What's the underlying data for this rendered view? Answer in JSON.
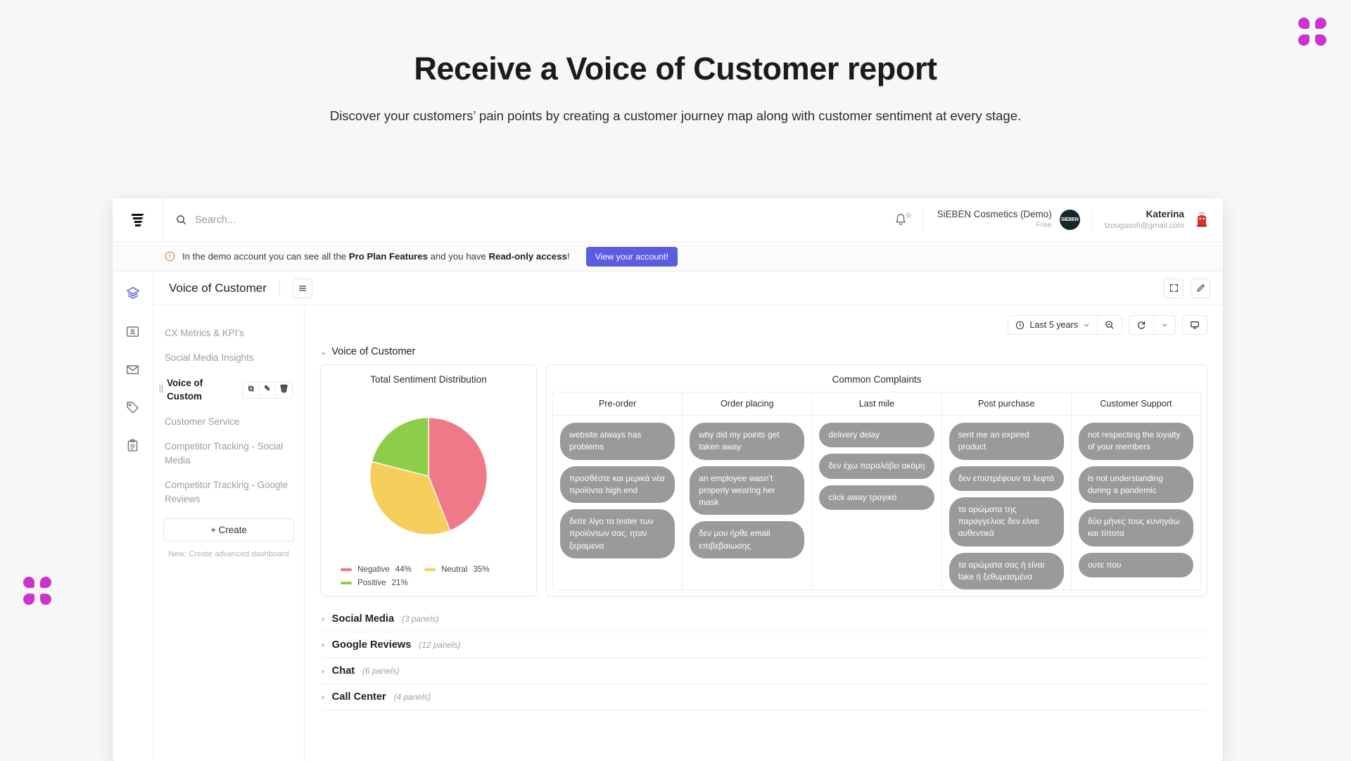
{
  "page": {
    "title": "Receive a Voice of Customer report",
    "subtitle": "Discover your customers’ pain points by creating a customer journey map along with customer sentiment at every stage."
  },
  "decor": {
    "petal_color": "#cc33cc"
  },
  "topbar": {
    "logo_icon": "app-logo-icon",
    "search_icon": "search-icon",
    "search_placeholder": "Search...",
    "bell_icon": "bell-icon",
    "org_name": "SiEBEN Cosmetics (Demo)",
    "org_plan": "Free",
    "org_avatar_text": "SiEBEN",
    "user_name": "Katerina",
    "user_email": "tzougasofi@gmail.com",
    "user_avatar_icon": "user-avatar-icon"
  },
  "banner": {
    "warn_icon": "warning-circle-icon",
    "text_1": "In the demo account you can see all the ",
    "bold_1": "Pro Plan Features",
    "text_2": " and you have ",
    "bold_2": "Read-only access",
    "text_3": "!",
    "button_label": "View your account!",
    "button_color": "#5b5ce2"
  },
  "rail": {
    "items": [
      {
        "icon": "layers-icon",
        "active": true
      },
      {
        "icon": "contact-card-icon",
        "active": false
      },
      {
        "icon": "envelope-icon",
        "active": false
      },
      {
        "icon": "tag-icon",
        "active": false
      },
      {
        "icon": "clipboard-icon",
        "active": false
      }
    ],
    "active_color": "#5b5ce2"
  },
  "dashboard_titlebar": {
    "title": "Voice of Customer",
    "menu_icon": "hamburger-icon",
    "fullscreen_icon": "fullscreen-icon",
    "edit_icon": "pencil-icon"
  },
  "sidebar": {
    "items": [
      {
        "label": "CX Metrics & KPI's",
        "active": false
      },
      {
        "label": "Social Media Insights",
        "active": false
      },
      {
        "label": "Voice of Custom",
        "active": true
      },
      {
        "label": "Customer Service",
        "active": false
      },
      {
        "label": "Competitor Tracking - Social Media",
        "active": false
      },
      {
        "label": "Competitor Tracking - Google Reviews",
        "active": false
      }
    ],
    "active_actions": [
      {
        "icon": "duplicate-icon",
        "glyph": "⧉"
      },
      {
        "icon": "pencil-icon",
        "glyph": "✎"
      },
      {
        "icon": "trash-icon",
        "glyph": "🗑"
      }
    ],
    "create_label": "+ Create",
    "create_hint": "New: Create advanced dashboard"
  },
  "toolbar": {
    "clock_icon": "clock-icon",
    "date_range": "Last 5 years",
    "chevron_icon": "chevron-down-icon",
    "zoom_out_icon": "zoom-out-icon",
    "refresh_icon": "refresh-icon",
    "refresh_chevron_icon": "chevron-down-icon",
    "presentation_icon": "monitor-icon"
  },
  "section": {
    "expanded_label": "Voice of Customer",
    "expanded_chevron": "chevron-down-icon"
  },
  "chart_data": {
    "type": "pie",
    "title": "Total Sentiment Distribution",
    "categories": [
      "Negative",
      "Neutral",
      "Positive"
    ],
    "values": [
      44,
      35,
      21
    ],
    "value_labels": [
      "44%",
      "35%",
      "21%"
    ],
    "colors": [
      "#ef7a87",
      "#f5ce5c",
      "#8dce49"
    ],
    "legend_position": "bottom-left",
    "units": "percent"
  },
  "complaints": {
    "title": "Common Complaints",
    "columns": [
      {
        "header": "Pre-order",
        "items": [
          "website always has problems",
          "προσθέστε και μερικά νέα προϊόντα high end",
          "δείτε λίγο τα tester των προϊόντων σας, ηταν ξεραμενα"
        ]
      },
      {
        "header": "Order placing",
        "items": [
          "why did my points get taken away",
          "an employee wasn’t properly wearing her mask",
          "δεν μου ήρθε email επιβεβαιωσης"
        ]
      },
      {
        "header": "Last mile",
        "items": [
          "delivery delay",
          "δεν έχω παραλάβει ακόμη",
          "click away τραγικό"
        ]
      },
      {
        "header": "Post purchase",
        "items": [
          "sent me an expired product",
          "δεν επιστρέφουν τα λεφτά",
          "τα αρώματα της παραγγελιας δεν είναι αυθεντικά",
          "τα αρώματα σας ή είναι fake ή ξεθυμασμένα"
        ]
      },
      {
        "header": "Customer Support",
        "items": [
          "not respecting the loyalty of your members",
          "is not understanding during a pandemic",
          "δύο μήνες τους κυνηγάω και τίποτα",
          "ουτε που"
        ]
      }
    ],
    "bubble_color": "#9a9a9a"
  },
  "collapsed_sections": [
    {
      "title": "Social Media",
      "count": "(3 panels)"
    },
    {
      "title": "Google Reviews",
      "count": "(12 panels)"
    },
    {
      "title": "Chat",
      "count": "(6 panels)"
    },
    {
      "title": "Call Center",
      "count": "(4 panels)"
    }
  ]
}
